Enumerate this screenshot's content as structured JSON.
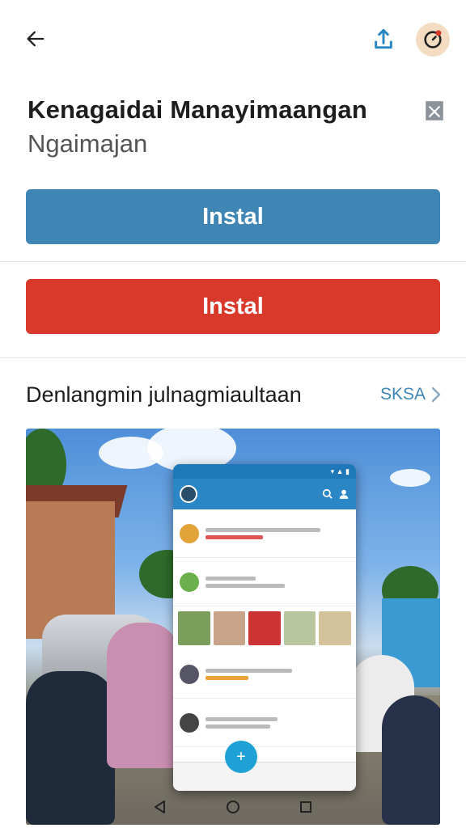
{
  "header": {
    "back_icon": "arrow-left-icon",
    "share_icon": "share-icon",
    "avatar_icon": "avatar-icon"
  },
  "app": {
    "title": "Kenagaidai Manayimaangan",
    "subtitle": "Ngaimajan",
    "bookmark_icon": "bookmark-icon"
  },
  "buttons": {
    "install_primary": "Instal",
    "install_secondary": "Instal"
  },
  "section": {
    "title": "Denlangmin julnagmiaultaan",
    "link_label": "SKSA",
    "link_icon": "chevron-right-icon"
  },
  "colors": {
    "primary_button": "#3f86b5",
    "secondary_button": "#d9392b",
    "link": "#3f86b5"
  },
  "navbar": {
    "back_icon": "nav-back-icon",
    "home_icon": "nav-home-icon",
    "recents_icon": "nav-recents-icon"
  }
}
